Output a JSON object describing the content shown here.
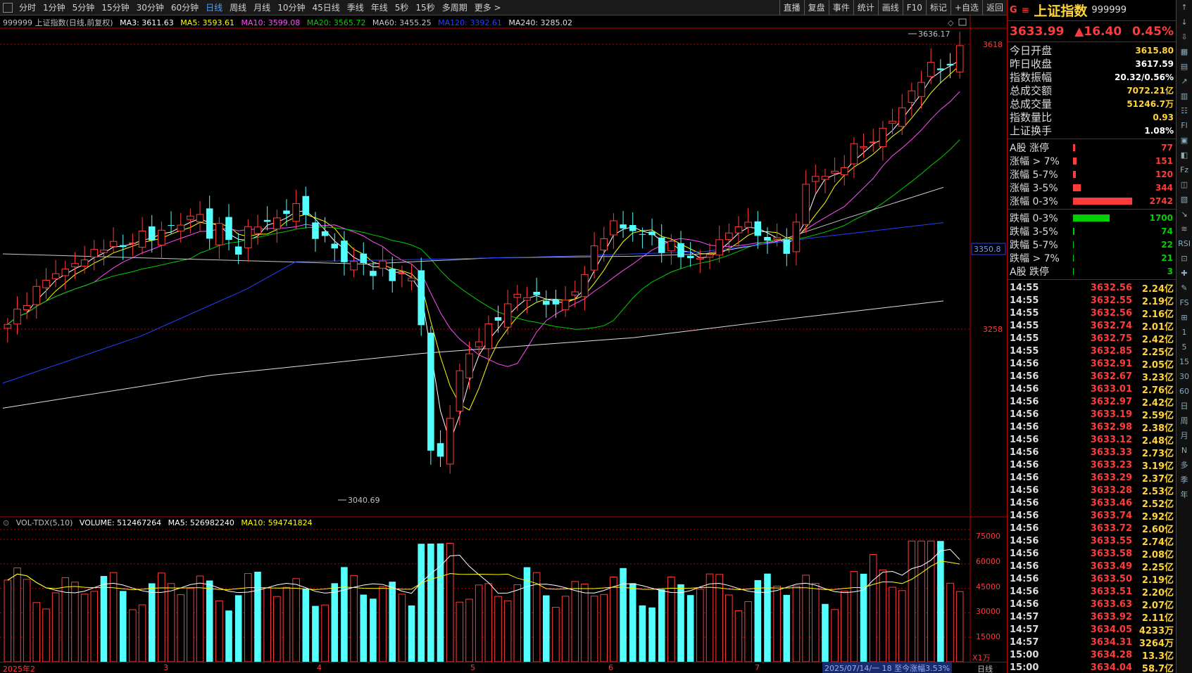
{
  "toolbar": {
    "items": [
      "分时",
      "1分钟",
      "5分钟",
      "15分钟",
      "30分钟",
      "60分钟",
      "日线",
      "周线",
      "月线",
      "10分钟",
      "45日线",
      "季线",
      "年线",
      "5秒",
      "15秒",
      "多周期",
      "更多 >"
    ],
    "active": "日线",
    "right_items": [
      "直播",
      "复盘",
      "事件",
      "统计",
      "画线",
      "F10",
      "标记",
      "+自选",
      "返回"
    ]
  },
  "legend": {
    "title": "999999 上证指数(日线,前复权)",
    "ma3": "MA3: 3611.63",
    "ma5": "MA5: 3593.61",
    "ma10": "MA10: 3599.08",
    "ma20": "MA20: 3565.72",
    "ma60": "MA60: 3455.25",
    "ma120": "MA120: 3392.61",
    "ma240": "MA240: 3285.02"
  },
  "vol_legend": {
    "title": "VOL-TDX(5,10)",
    "volume": "VOLUME: 512467264",
    "ma5": "MA5: 526982240",
    "ma10": "MA10: 594741824"
  },
  "price_axis": {
    "labels": [
      "3618",
      "3350.8",
      "3258"
    ],
    "high_label": "3636.17",
    "low_label": "3040.69"
  },
  "vol_axis": {
    "labels": [
      "75000",
      "60000",
      "45000",
      "30000",
      "15000"
    ],
    "unit": "X1万"
  },
  "x_axis": {
    "labels": [
      "2025年2",
      "3",
      "4",
      "5",
      "6",
      "7"
    ],
    "status": "2025/07/14/一 18 至今涨幅3.53%",
    "period": "日线"
  },
  "colors": {
    "up": "#ff3b3b",
    "down": "#54ffff",
    "ma3": "#ffffff",
    "ma5": "#ffff00",
    "ma10": "#ff4dff",
    "ma20": "#00d000",
    "ma60": "#c8c8c8",
    "ma120": "#2340ff",
    "ma240": "#e0e0e0"
  },
  "panel": {
    "g": "G",
    "menu": "≡",
    "name": "上证指数",
    "code": "999999",
    "price": "3633.99",
    "change": "▲16.40",
    "pct": "0.45%",
    "stats": [
      {
        "k": "今日开盘",
        "v": "3615.80",
        "c": "#ffd43b"
      },
      {
        "k": "昨日收盘",
        "v": "3617.59",
        "c": "#ffffff"
      },
      {
        "k": "指数振幅",
        "v": "20.32/0.56%",
        "c": "#ffffff"
      },
      {
        "k": "总成交额",
        "v": "7072.21亿",
        "c": "#ffd43b"
      },
      {
        "k": "总成交量",
        "v": "51246.7万",
        "c": "#ffd43b"
      },
      {
        "k": "指数量比",
        "v": "0.93",
        "c": "#ffd43b"
      },
      {
        "k": "上证换手",
        "v": "1.08%",
        "c": "#ffffff"
      }
    ],
    "up_dist": [
      {
        "k": "A股 涨停",
        "v": "77",
        "w": 3
      },
      {
        "k": "涨幅 > 7%",
        "v": "151",
        "w": 5
      },
      {
        "k": "涨幅 5-7%",
        "v": "120",
        "w": 4
      },
      {
        "k": "涨幅 3-5%",
        "v": "344",
        "w": 11
      },
      {
        "k": "涨幅 0-3%",
        "v": "2742",
        "w": 84
      }
    ],
    "down_dist": [
      {
        "k": "跌幅 0-3%",
        "v": "1700",
        "w": 52
      },
      {
        "k": "跌幅 3-5%",
        "v": "74",
        "w": 2
      },
      {
        "k": "跌幅 5-7%",
        "v": "22",
        "w": 1
      },
      {
        "k": "跌幅 > 7%",
        "v": "21",
        "w": 1
      },
      {
        "k": "A股 跌停",
        "v": "3",
        "w": 1
      }
    ],
    "ticks": [
      {
        "t": "14:55",
        "p": "3632.56",
        "a": "2.24亿"
      },
      {
        "t": "14:55",
        "p": "3632.55",
        "a": "2.19亿"
      },
      {
        "t": "14:55",
        "p": "3632.56",
        "a": "2.16亿"
      },
      {
        "t": "14:55",
        "p": "3632.74",
        "a": "2.01亿"
      },
      {
        "t": "14:55",
        "p": "3632.75",
        "a": "2.42亿"
      },
      {
        "t": "14:55",
        "p": "3632.85",
        "a": "2.25亿"
      },
      {
        "t": "14:56",
        "p": "3632.91",
        "a": "2.05亿"
      },
      {
        "t": "14:56",
        "p": "3632.67",
        "a": "3.23亿"
      },
      {
        "t": "14:56",
        "p": "3633.01",
        "a": "2.76亿"
      },
      {
        "t": "14:56",
        "p": "3632.97",
        "a": "2.42亿"
      },
      {
        "t": "14:56",
        "p": "3633.19",
        "a": "2.59亿"
      },
      {
        "t": "14:56",
        "p": "3632.98",
        "a": "2.38亿"
      },
      {
        "t": "14:56",
        "p": "3633.12",
        "a": "2.48亿"
      },
      {
        "t": "14:56",
        "p": "3633.33",
        "a": "2.73亿"
      },
      {
        "t": "14:56",
        "p": "3633.23",
        "a": "3.19亿"
      },
      {
        "t": "14:56",
        "p": "3633.29",
        "a": "2.37亿"
      },
      {
        "t": "14:56",
        "p": "3633.28",
        "a": "2.53亿"
      },
      {
        "t": "14:56",
        "p": "3633.46",
        "a": "2.52亿"
      },
      {
        "t": "14:56",
        "p": "3633.74",
        "a": "2.92亿"
      },
      {
        "t": "14:56",
        "p": "3633.72",
        "a": "2.60亿"
      },
      {
        "t": "14:56",
        "p": "3633.55",
        "a": "2.74亿"
      },
      {
        "t": "14:56",
        "p": "3633.58",
        "a": "2.08亿"
      },
      {
        "t": "14:56",
        "p": "3633.49",
        "a": "2.25亿"
      },
      {
        "t": "14:56",
        "p": "3633.50",
        "a": "2.19亿"
      },
      {
        "t": "14:56",
        "p": "3633.51",
        "a": "2.20亿"
      },
      {
        "t": "14:56",
        "p": "3633.63",
        "a": "2.07亿"
      },
      {
        "t": "14:57",
        "p": "3633.92",
        "a": "2.11亿"
      },
      {
        "t": "14:57",
        "p": "3634.05",
        "a": "4233万"
      },
      {
        "t": "14:57",
        "p": "3634.31",
        "a": "3264万"
      },
      {
        "t": "15:00",
        "p": "3634.28",
        "a": "13.3亿"
      },
      {
        "t": "15:00",
        "p": "3634.04",
        "a": "58.7亿"
      }
    ]
  },
  "sidebar": [
    "↑",
    "↓",
    "⇩",
    "▦",
    "▤",
    "↗",
    "▥",
    "☷",
    "Fl",
    "▣",
    "◧",
    "Fz",
    "◫",
    "▧",
    "↘",
    "≋",
    "RSI",
    "⊡",
    "✚",
    "✎",
    "FS",
    "⊞",
    "1",
    "5",
    "15",
    "30",
    "60",
    "日",
    "周",
    "月",
    "N",
    "多",
    "季",
    "年"
  ],
  "chart_data": {
    "type": "candlestick",
    "x_labels": [
      "2025年2",
      "3",
      "4",
      "5",
      "6",
      "7"
    ],
    "price_range": [
      3040.69,
      3636.17
    ],
    "high": 3636.17,
    "low": 3040.69,
    "last_close": 3633.99,
    "volume_range": [
      0,
      75000
    ],
    "volume_unit": "X1万"
  }
}
